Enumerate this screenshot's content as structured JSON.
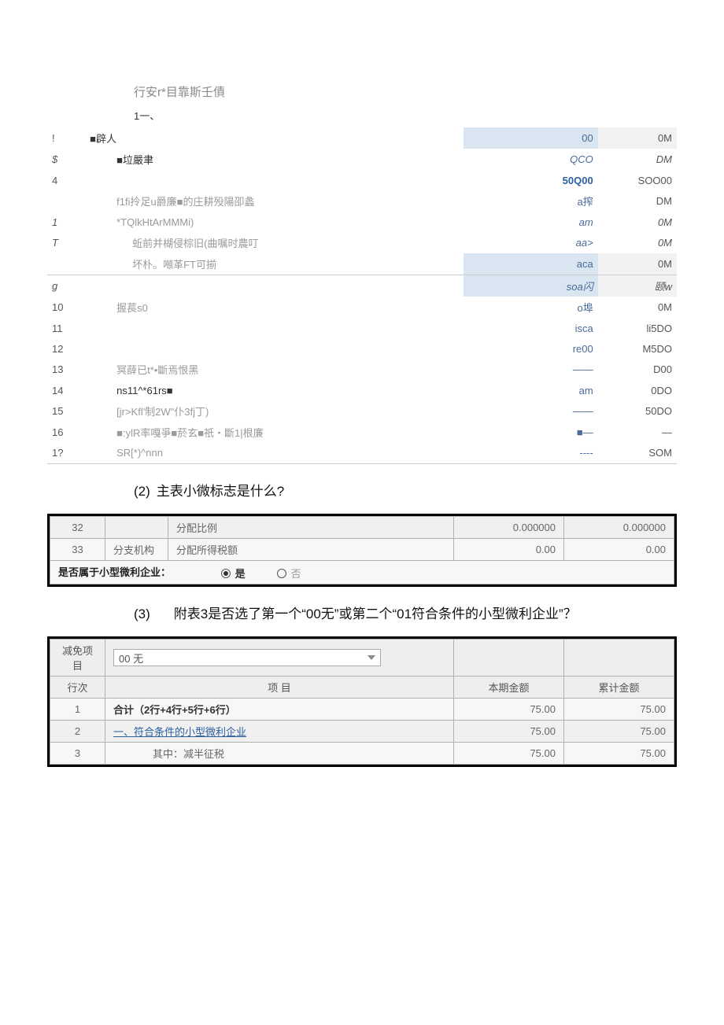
{
  "table1": {
    "title": "行安r*目靠斯壬債",
    "subtitle": "1一、",
    "rows": [
      {
        "num": "!",
        "item": "■辟人",
        "v1": "00",
        "v2": "0M",
        "bold": true,
        "hl": true
      },
      {
        "num": "$",
        "item": "■垃嚴聿",
        "v1": "QCO",
        "v2": "DM",
        "bold": true,
        "indent": 1,
        "ital": true
      },
      {
        "num": "4",
        "item": "",
        "v1": "50Q00",
        "v2": "SOO00",
        "bold": true,
        "blue": true
      },
      {
        "num": "",
        "item": "f1fi拎足u爵廉■的庄耕殁陽卲蠡",
        "v1": "a搾",
        "v2": "DM",
        "indent": 1
      },
      {
        "num": "1",
        "item": "*TQlkHtArMMMi)",
        "v1": "am",
        "v2": "0M",
        "indent": 1,
        "ital": true
      },
      {
        "num": "T",
        "item": "蚯前并楜侵棕旧(曲嘱时農叮",
        "v1": "aa>",
        "v2": "0M",
        "indent": 2,
        "ital": true
      },
      {
        "num": "",
        "item": "坏朴。噸革FT可揃",
        "v1": "aca",
        "v2": "0M",
        "indent": 2,
        "hl": true,
        "border": true
      },
      {
        "num": "g",
        "item": "",
        "v1": "soa闪",
        "v2": "颐w",
        "hl": true,
        "ital": true
      },
      {
        "num": "10",
        "item": "握萇s0",
        "v1": "o埠",
        "v2": "0M",
        "indent": 1
      },
      {
        "num": "11",
        "item": "",
        "v1": "isca",
        "v2": "li5DO"
      },
      {
        "num": "12",
        "item": "",
        "v1": "re00",
        "v2": "M5DO"
      },
      {
        "num": "13",
        "item": "冥薛已t*•斷焉恨黑",
        "v1": "——",
        "v2": "D00",
        "indent": 1
      },
      {
        "num": "14",
        "item": "ns11^*61rs■",
        "v1": "am",
        "v2": "0DO",
        "indent": 1,
        "bold": true
      },
      {
        "num": "15",
        "item": "[jr>Kfl'制2W\"仆3fj丁)",
        "v1": "——",
        "v2": "50DO",
        "indent": 1
      },
      {
        "num": "16",
        "item": "■:ylR率嘎爭■菸玄■祇・斷1|根廉",
        "v1": "■—",
        "v2": "—",
        "indent": 1
      },
      {
        "num": "1?",
        "item": "SR[*)^nnn",
        "v1": "----",
        "v2": "SOM",
        "indent": 1,
        "border": true
      }
    ]
  },
  "q2": {
    "num": "(2)",
    "text": "主表小微标志是什么?"
  },
  "table2": {
    "rows": [
      {
        "num": "32",
        "branch": "",
        "item": "分配比例",
        "v1": "0.000000",
        "v2": "0.000000"
      },
      {
        "num": "33",
        "branch": "分支机构",
        "item": "分配所得税额",
        "v1": "0.00",
        "v2": "0.00"
      }
    ],
    "question": "是否属于小型微利企业：",
    "opts": {
      "yes": "是",
      "no": "否"
    },
    "selected": "yes"
  },
  "q3": {
    "num": "(3)",
    "text": "附表3是否选了第一个“00无”或第二个“01符合条件的小型微利企业”？"
  },
  "table3": {
    "sel_label": "减免项目",
    "sel_value": "00  无",
    "headers": {
      "row": "行次",
      "item": "项        目",
      "v1": "本期金额",
      "v2": "累计金额"
    },
    "rows": [
      {
        "num": "1",
        "item": "合计（2行+4行+5行+6行）",
        "v1": "75.00",
        "v2": "75.00",
        "bold": true
      },
      {
        "num": "2",
        "item": "一、符合条件的小型微利企业",
        "v1": "75.00",
        "v2": "75.00",
        "link": true
      },
      {
        "num": "3",
        "item": "其中：减半征税",
        "v1": "75.00",
        "v2": "75.00",
        "indent": true
      }
    ]
  }
}
